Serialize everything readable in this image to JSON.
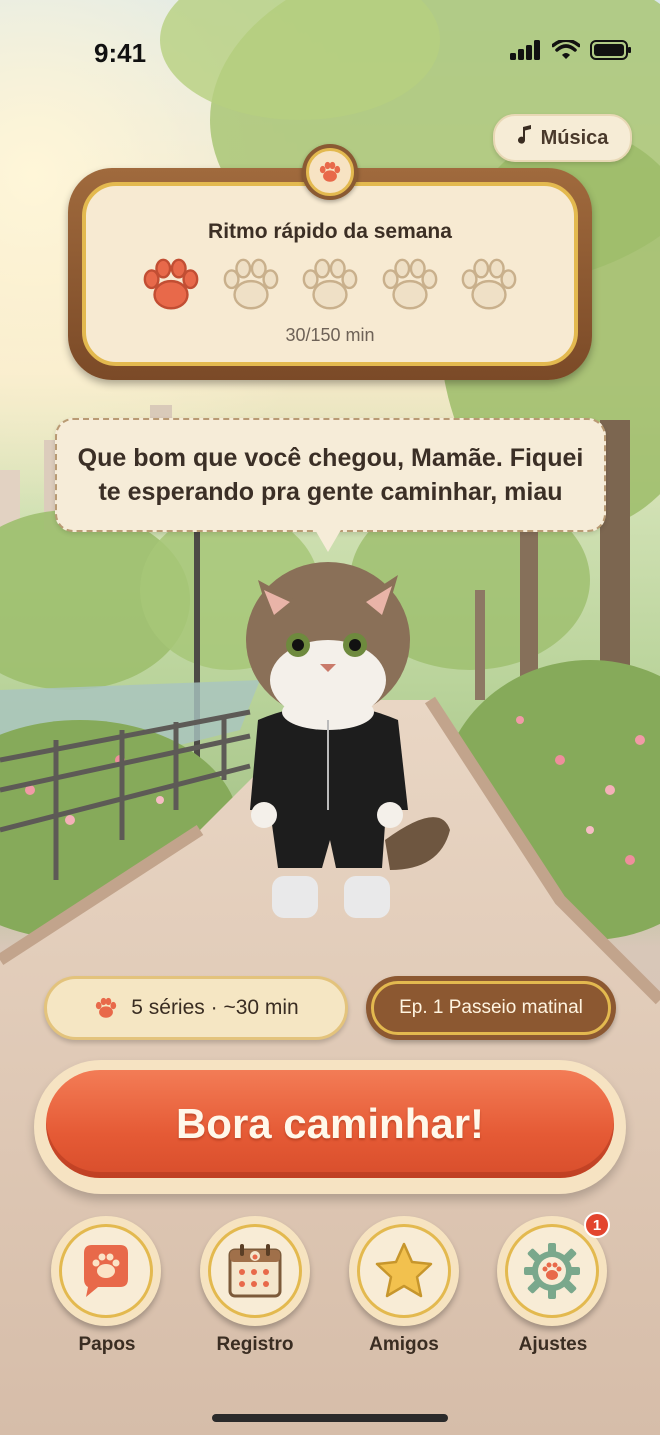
{
  "status_bar": {
    "time": "9:41"
  },
  "music_button": {
    "label": "Música",
    "icon": "music-note-icon"
  },
  "weekly_panel": {
    "title": "Ritmo rápido da semana",
    "progress_text": "30/150 min",
    "paws_total": 5,
    "paws_filled": 1,
    "filled_color": "#e8694a",
    "empty_color": "#efe0c6"
  },
  "speech_bubble": {
    "text": "Que bom que você chegou, Mamãe. Fiquei te esperando pra gente caminhar, miau"
  },
  "session_chip": {
    "label": "5 séries · ~30 min",
    "icon": "paw-icon"
  },
  "episode_chip": {
    "label": "Ep. 1 Passeio matinal"
  },
  "cta": {
    "label": "Bora caminhar!",
    "color": "#e55a35"
  },
  "nav": [
    {
      "label": "Papos",
      "icon": "chat-bubble-paw-icon"
    },
    {
      "label": "Registro",
      "icon": "calendar-paw-icon"
    },
    {
      "label": "Amigos",
      "icon": "star-icon"
    },
    {
      "label": "Ajustes",
      "icon": "gear-paw-icon",
      "badge": "1"
    }
  ]
}
